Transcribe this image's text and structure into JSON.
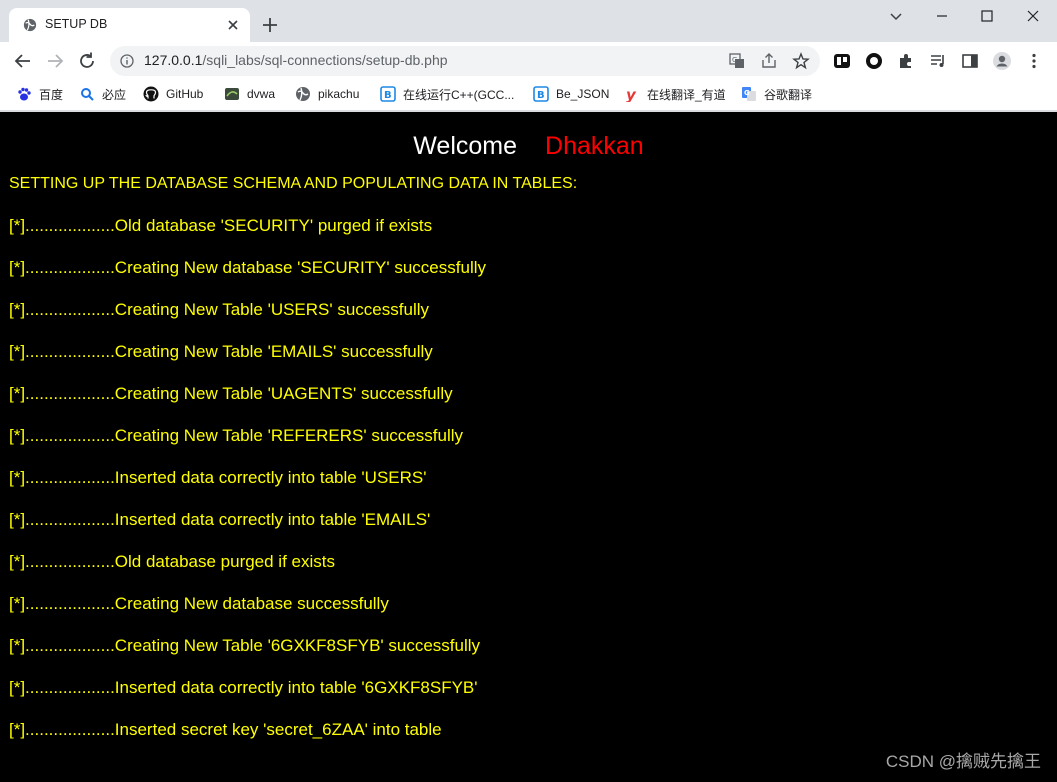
{
  "browser": {
    "tab": {
      "title": "SETUP DB",
      "favicon": "globe-icon"
    },
    "url": {
      "host": "127.0.0.1",
      "path": "/sqli_labs/sql-connections/setup-db.php"
    },
    "bookmarks": [
      {
        "label": "百度",
        "icon": "baidu-icon"
      },
      {
        "label": "必应",
        "icon": "bing-icon"
      },
      {
        "label": "GitHub",
        "icon": "github-icon"
      },
      {
        "label": "dvwa",
        "icon": "dvwa-icon"
      },
      {
        "label": "pikachu",
        "icon": "globe-icon"
      },
      {
        "label": "在线运行C++(GCC...",
        "icon": "runcode-icon"
      },
      {
        "label": "Be_JSON",
        "icon": "bejson-icon"
      },
      {
        "label": "在线翻译_有道",
        "icon": "youdao-icon"
      },
      {
        "label": "谷歌翻译",
        "icon": "google-translate-icon"
      }
    ]
  },
  "page": {
    "welcome": "Welcome",
    "name": "Dhakkan",
    "heading": "SETTING UP THE DATABASE SCHEMA AND POPULATING DATA IN TABLES:",
    "log": [
      "[*]...................Old database 'SECURITY' purged if exists",
      "[*]...................Creating New database 'SECURITY' successfully",
      "[*]...................Creating New Table 'USERS' successfully",
      "[*]...................Creating New Table 'EMAILS' successfully",
      "[*]...................Creating New Table 'UAGENTS' successfully",
      "[*]...................Creating New Table 'REFERERS' successfully",
      "[*]...................Inserted data correctly into table 'USERS'",
      "[*]...................Inserted data correctly into table 'EMAILS'",
      "[*]...................Old database purged if exists",
      "[*]...................Creating New database successfully",
      "[*]...................Creating New Table '6GXKF8SFYB' successfully",
      "[*]...................Inserted data correctly into table '6GXKF8SFYB'",
      "[*]...................Inserted secret key 'secret_6ZAA' into table"
    ],
    "watermark": "CSDN @擒贼先擒王"
  },
  "colors": {
    "welcome": "#ffffff",
    "name": "#ff0000",
    "log_text": "#ffff00",
    "page_bg": "#000000"
  }
}
